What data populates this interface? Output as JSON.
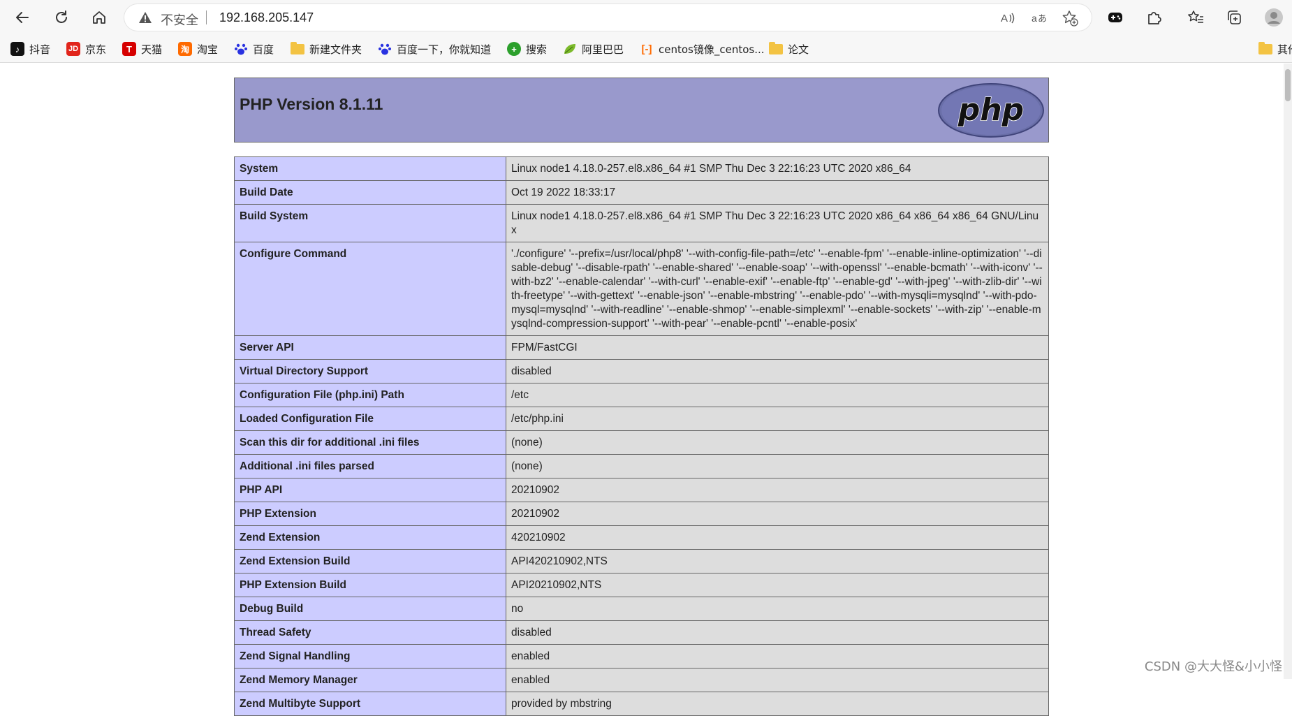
{
  "browser": {
    "address_insecure_label": "不安全",
    "url": "192.168.205.147"
  },
  "bookmarks": [
    {
      "label": "抖音",
      "icon": "douyin-icon"
    },
    {
      "label": "京东",
      "icon": "jd-icon"
    },
    {
      "label": "天猫",
      "icon": "tmall-icon"
    },
    {
      "label": "淘宝",
      "icon": "taobao-icon"
    },
    {
      "label": "百度",
      "icon": "baidu-icon"
    },
    {
      "label": "新建文件夹",
      "icon": "folder-icon"
    },
    {
      "label": "百度一下，你就知道",
      "icon": "baidu-icon"
    },
    {
      "label": "搜索",
      "icon": "search-plus-icon"
    },
    {
      "label": "阿里巴巴",
      "icon": "leaf-icon"
    },
    {
      "label": "centos镜像_centos...",
      "icon": "aliyun-icon"
    },
    {
      "label": "论文",
      "icon": "folder-icon"
    },
    {
      "label": "其他",
      "icon": "folder-icon"
    }
  ],
  "page": {
    "title": "PHP Version 8.1.11",
    "logo_text": "php"
  },
  "rows": [
    {
      "key": "System",
      "value": "Linux node1 4.18.0-257.el8.x86_64 #1 SMP Thu Dec 3 22:16:23 UTC 2020 x86_64"
    },
    {
      "key": "Build Date",
      "value": "Oct 19 2022 18:33:17"
    },
    {
      "key": "Build System",
      "value": "Linux node1 4.18.0-257.el8.x86_64 #1 SMP Thu Dec 3 22:16:23 UTC 2020 x86_64 x86_64 x86_64 GNU/Linux"
    },
    {
      "key": "Configure Command",
      "value": "'./configure' '--prefix=/usr/local/php8' '--with-config-file-path=/etc' '--enable-fpm' '--enable-inline-optimization' '--disable-debug' '--disable-rpath' '--enable-shared' '--enable-soap' '--with-openssl' '--enable-bcmath' '--with-iconv' '--with-bz2' '--enable-calendar' '--with-curl' '--enable-exif' '--enable-ftp' '--enable-gd' '--with-jpeg' '--with-zlib-dir' '--with-freetype' '--with-gettext' '--enable-json' '--enable-mbstring' '--enable-pdo' '--with-mysqli=mysqlnd' '--with-pdo-mysql=mysqlnd' '--with-readline' '--enable-shmop' '--enable-simplexml' '--enable-sockets' '--with-zip' '--enable-mysqlnd-compression-support' '--with-pear' '--enable-pcntl' '--enable-posix'"
    },
    {
      "key": "Server API",
      "value": "FPM/FastCGI"
    },
    {
      "key": "Virtual Directory Support",
      "value": "disabled"
    },
    {
      "key": "Configuration File (php.ini) Path",
      "value": "/etc"
    },
    {
      "key": "Loaded Configuration File",
      "value": "/etc/php.ini"
    },
    {
      "key": "Scan this dir for additional .ini files",
      "value": "(none)"
    },
    {
      "key": "Additional .ini files parsed",
      "value": "(none)"
    },
    {
      "key": "PHP API",
      "value": "20210902"
    },
    {
      "key": "PHP Extension",
      "value": "20210902"
    },
    {
      "key": "Zend Extension",
      "value": "420210902"
    },
    {
      "key": "Zend Extension Build",
      "value": "API420210902,NTS"
    },
    {
      "key": "PHP Extension Build",
      "value": "API20210902,NTS"
    },
    {
      "key": "Debug Build",
      "value": "no"
    },
    {
      "key": "Thread Safety",
      "value": "disabled"
    },
    {
      "key": "Zend Signal Handling",
      "value": "enabled"
    },
    {
      "key": "Zend Memory Manager",
      "value": "enabled"
    },
    {
      "key": "Zend Multibyte Support",
      "value": "provided by mbstring"
    }
  ],
  "watermark": "CSDN @大大怪&小小怪"
}
